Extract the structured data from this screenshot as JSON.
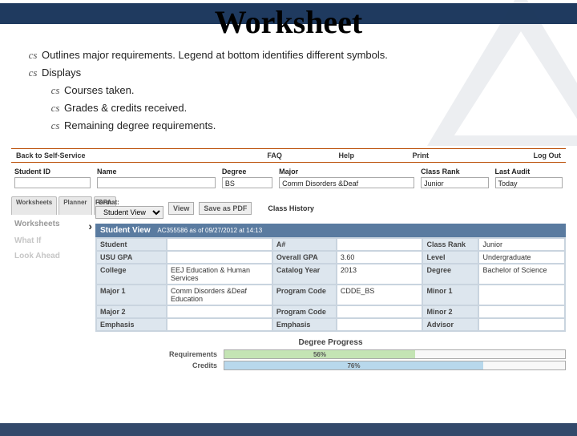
{
  "title": "Worksheet",
  "bullets": {
    "outline": "Outlines major requirements. Legend at bottom identifies different symbols.",
    "displays": "Displays",
    "sub": [
      "Courses taken.",
      "Grades & credits received.",
      "Remaining degree requirements."
    ]
  },
  "nav": [
    "Back to Self-Service",
    "FAQ",
    "Help",
    "Print",
    "Log Out"
  ],
  "header_fields": {
    "student_id": {
      "label": "Student ID",
      "value": ""
    },
    "name": {
      "label": "Name",
      "value": ""
    },
    "degree": {
      "label": "Degree",
      "value": "BS"
    },
    "major": {
      "label": "Major",
      "value": "Comm Disorders &Deaf"
    },
    "class_rank": {
      "label": "Class Rank",
      "value": "Junior"
    },
    "last_audit": {
      "label": "Last Audit",
      "value": "Today"
    }
  },
  "side_tabs": [
    "Worksheets",
    "Planner",
    "GPA Calc"
  ],
  "side_nav": {
    "active": "Worksheets",
    "what_if": "What If",
    "look_ahead": "Look Ahead"
  },
  "toolbar": {
    "format_label": "Format:",
    "format_value": "Student View",
    "view": "View",
    "save_pdf": "Save as PDF",
    "class_history": "Class History"
  },
  "banner": {
    "title": "Student View",
    "meta": "AC355586 as of 09/27/2012 at 14:13"
  },
  "info": {
    "r1": {
      "student_lbl": "Student",
      "student_val": "",
      "anum_lbl": "A#",
      "anum_val": "",
      "rank_lbl": "Class Rank",
      "rank_val": "Junior"
    },
    "r2": {
      "usu_lbl": "USU GPA",
      "usu_val": "",
      "ogpa_lbl": "Overall GPA",
      "ogpa_val": "3.60",
      "level_lbl": "Level",
      "level_val": "Undergraduate"
    },
    "r3": {
      "col_lbl": "College",
      "col_val": "EEJ Education & Human Services",
      "cy_lbl": "Catalog Year",
      "cy_val": "2013",
      "deg_lbl": "Degree",
      "deg_val": "Bachelor of Science"
    },
    "r4": {
      "m1_lbl": "Major 1",
      "m1_val": "Comm Disorders &Deaf Education",
      "pc_lbl": "Program Code",
      "pc_val": "CDDE_BS",
      "mn1_lbl": "Minor 1",
      "mn1_val": ""
    },
    "r5": {
      "m2_lbl": "Major 2",
      "m2_val": "",
      "pc2_lbl": "Program Code",
      "pc2_val": "",
      "mn2_lbl": "Minor 2",
      "mn2_val": ""
    },
    "r6": {
      "em_lbl": "Emphasis",
      "em_val": "",
      "em2_lbl": "Emphasis",
      "em2_val": "",
      "adv_lbl": "Advisor",
      "adv_val": ""
    }
  },
  "progress": {
    "title": "Degree Progress",
    "requirements": {
      "label": "Requirements",
      "pct_text": "56%",
      "pct": 56
    },
    "credits": {
      "label": "Credits",
      "pct_text": "76%",
      "pct": 76
    }
  }
}
